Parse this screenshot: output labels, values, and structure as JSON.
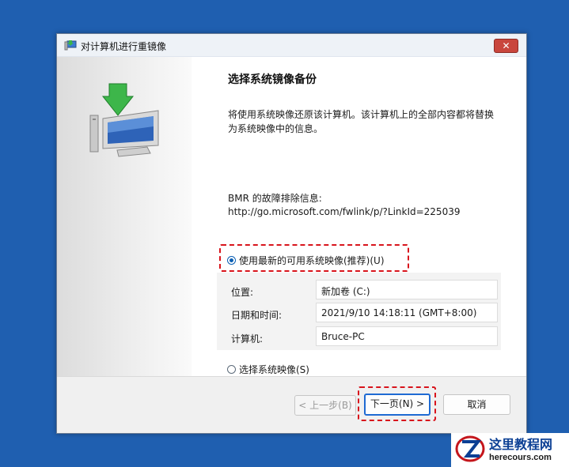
{
  "window": {
    "title": "对计算机进行重镜像",
    "close_label": "✕"
  },
  "main": {
    "heading": "选择系统镜像备份",
    "description": "将使用系统映像还原该计算机。该计算机上的全部内容都将替换为系统映像中的信息。",
    "bmr_label": "BMR 的故障排除信息:",
    "bmr_link": "http://go.microsoft.com/fwlink/p/?LinkId=225039",
    "option_latest": "使用最新的可用系统映像(推荐)(U)",
    "option_select": "选择系统映像(S)",
    "info": {
      "location_label": "位置:",
      "location_value": "新加卷 (C:)",
      "datetime_label": "日期和时间:",
      "datetime_value": "2021/9/10 14:18:11 (GMT+8:00)",
      "computer_label": "计算机:",
      "computer_value": "Bruce-PC"
    }
  },
  "footer": {
    "back_label": "< 上一步(B)",
    "next_label": "下一页(N) >",
    "cancel_label": "取消"
  },
  "watermark": {
    "site_name": "这里教程网",
    "url": "herecours.com"
  },
  "colors": {
    "desktop": "#1f5fb0",
    "highlight": "#d8141c",
    "accent": "#1e6ad3"
  }
}
